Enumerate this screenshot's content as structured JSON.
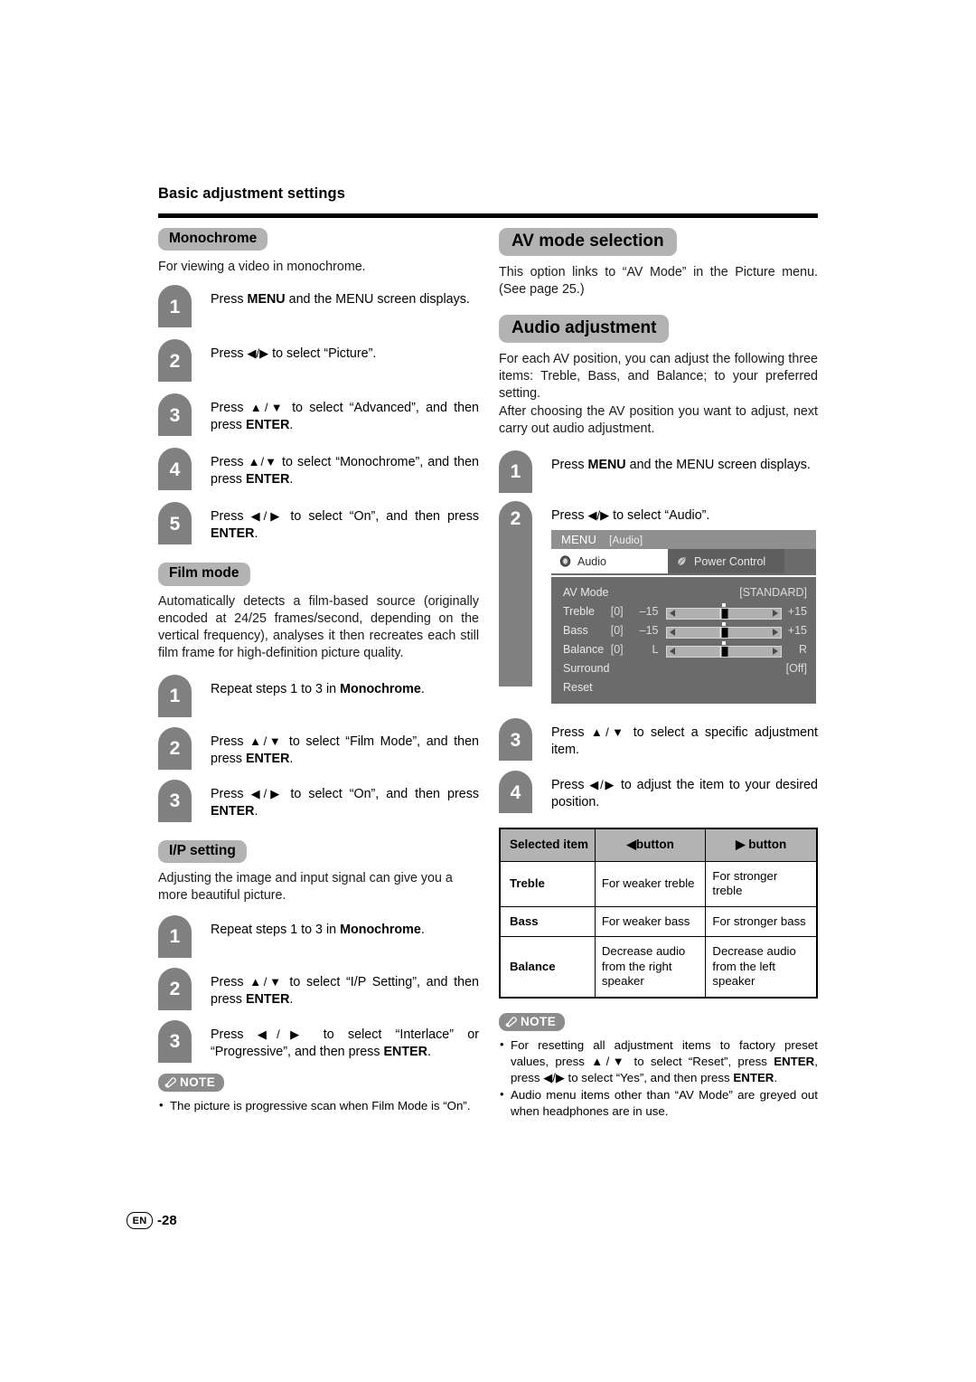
{
  "page": {
    "section_title": "Basic adjustment settings",
    "footer_lang": "EN",
    "footer_page": "-28"
  },
  "left_column": {
    "monochrome": {
      "heading": "Monochrome",
      "intro": "For viewing a video in monochrome.",
      "steps": [
        {
          "num": "1",
          "html": "Press <b>MENU</b> and the MENU screen displays."
        },
        {
          "num": "2",
          "html": "Press <span class=\"arrows\">◀/▶</span> to select “Picture”."
        },
        {
          "num": "3",
          "html": "Press <span class=\"arrows\">▲/▼</span> to select “Advanced”, and then press <b>ENTER</b>."
        },
        {
          "num": "4",
          "html": "Press <span class=\"arrows\">▲/▼</span> to select “Monochrome”, and then press <b>ENTER</b>."
        },
        {
          "num": "5",
          "html": "Press <span class=\"arrows\">◀/▶</span> to select “On”, and then press <b>ENTER</b>."
        }
      ]
    },
    "film_mode": {
      "heading": "Film mode",
      "intro": "Automatically detects a film-based source (originally encoded at 24/25 frames/second, depending on the vertical frequency), analyses it then recreates each still film frame for high-definition picture quality.",
      "steps": [
        {
          "num": "1",
          "html": "Repeat steps 1 to 3 in <b>Monochrome</b>."
        },
        {
          "num": "2",
          "html": "Press <span class=\"arrows\">▲/▼</span> to select “Film Mode”, and then press <b>ENTER</b>."
        },
        {
          "num": "3",
          "html": "Press <span class=\"arrows\">◀/▶</span> to select “On”, and then press <b>ENTER</b>."
        }
      ]
    },
    "ip_setting": {
      "heading": "I/P setting",
      "intro": "Adjusting the image and input signal can give you a more beautiful picture.",
      "steps": [
        {
          "num": "1",
          "html": "Repeat steps 1 to 3 in <b>Monochrome</b>."
        },
        {
          "num": "2",
          "html": "Press <span class=\"arrows\">▲/▼</span> to select “I/P Setting”, and then press <b>ENTER</b>."
        },
        {
          "num": "3",
          "html": "Press <span class=\"arrows\">◀/▶</span> to select “Interlace” or “Progressive”, and then press <b>ENTER</b>."
        }
      ]
    },
    "note": {
      "label": "NOTE",
      "items": [
        "The picture is progressive scan when Film Mode is “On”."
      ]
    }
  },
  "right_column": {
    "av_mode_selection": {
      "heading": "AV mode selection",
      "body": "This option links to “AV Mode” in the Picture menu. (See page 25.)"
    },
    "audio_adjustment": {
      "heading": "Audio adjustment",
      "body_1": "For each AV position, you can adjust the following three items: Treble, Bass, and Balance; to your preferred setting.",
      "body_2": "After choosing the AV position you want to adjust, next carry out audio adjustment.",
      "steps": [
        {
          "num": "1",
          "html": "Press <b>MENU</b> and the MENU screen displays."
        },
        {
          "num": "2",
          "html": "Press <span class=\"arrows\">◀/▶</span> to select “Audio”."
        },
        {
          "num": "3",
          "html": "Press <span class=\"arrows\">▲/▼</span> to select a specific adjustment item."
        },
        {
          "num": "4",
          "html": "Press <span class=\"arrows\">◀/▶</span> to adjust the item to your desired position."
        }
      ]
    },
    "osd": {
      "title": "MENU",
      "title_tag": "[Audio]",
      "tabs": [
        {
          "label": "Audio",
          "icon": "speaker-icon",
          "active": true
        },
        {
          "label": "Power Control",
          "icon": "leaf-icon",
          "active": false
        }
      ],
      "rows": [
        {
          "label": "AV Mode",
          "value": "",
          "low": "",
          "high": "",
          "right": "[STANDARD]",
          "slider": false
        },
        {
          "label": "Treble",
          "value": "[0]",
          "low": "–15",
          "high": "+15",
          "right": "",
          "slider": true
        },
        {
          "label": "Bass",
          "value": "[0]",
          "low": "–15",
          "high": "+15",
          "right": "",
          "slider": true
        },
        {
          "label": "Balance",
          "value": "[0]",
          "low": "L",
          "high": "R",
          "right": "",
          "slider": true
        },
        {
          "label": "Surround",
          "value": "",
          "low": "",
          "high": "",
          "right": "[Off]",
          "slider": false
        },
        {
          "label": "Reset",
          "value": "",
          "low": "",
          "high": "",
          "right": "",
          "slider": false
        }
      ]
    },
    "button_table": {
      "headers": [
        "Selected item",
        "◀button",
        "▶ button"
      ],
      "rows": [
        {
          "item": "Treble",
          "left": "For weaker treble",
          "right": "For stronger treble"
        },
        {
          "item": "Bass",
          "left": "For weaker bass",
          "right": "For stronger bass"
        },
        {
          "item": "Balance",
          "left": "Decrease audio from the right speaker",
          "right": "Decrease audio from the left speaker"
        }
      ]
    },
    "note": {
      "label": "NOTE",
      "items_html": [
        "For resetting all adjustment items to factory preset values, press <span class=\"arrows\">▲/▼</span> to select “Reset”, press <b>ENTER</b>, press <span class=\"arrows\">◀/▶</span> to select “Yes”, and then press <b>ENTER</b>.",
        "Audio menu items other than “AV Mode” are greyed out when headphones are in use."
      ]
    }
  },
  "colors": {
    "pill_gray": "#b3b3b3",
    "badge_gray": "#808080",
    "osd_body": "#6b6b6b",
    "osd_title": "#8f8f8f",
    "note_gray": "#8c8c8c"
  }
}
